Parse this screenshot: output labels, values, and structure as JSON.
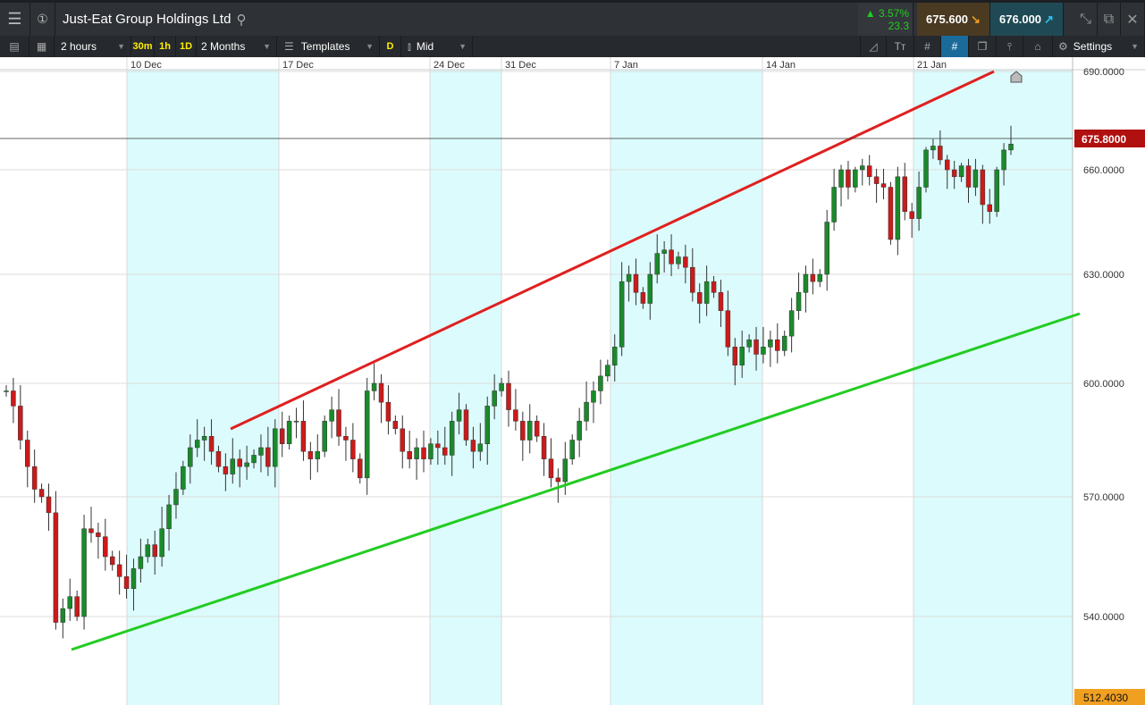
{
  "header": {
    "title": "Just-Eat Group Holdings Ltd",
    "change_pct": "3.57%",
    "change_abs": "23.3",
    "sell": "675.600",
    "buy": "676.000",
    "accent_up": "#22cc22",
    "sell_bg": "#4a3a22",
    "buy_bg": "#1f4a55"
  },
  "toolbar": {
    "interval": "2 hours",
    "quick": [
      "30m",
      "1h",
      "1D"
    ],
    "range": "2 Months",
    "templates": "Templates",
    "d": "D",
    "price_type": "Mid",
    "settings": "Settings"
  },
  "chart_data": {
    "type": "candlestick",
    "x_labels": [
      "10 Dec",
      "17 Dec",
      "24 Dec",
      "31 Dec",
      "7 Jan",
      "14 Jan",
      "21 Jan"
    ],
    "y_ticks": [
      "690.0000",
      "660.0000",
      "630.0000",
      "600.0000",
      "570.0000",
      "540.0000"
    ],
    "current_price": "675.8000",
    "bottom_label": "512.4030",
    "open": 598,
    "closes": [
      598,
      594,
      585,
      578,
      572,
      570,
      566,
      538,
      542,
      545,
      540,
      562,
      561,
      560,
      555,
      553,
      550,
      547,
      552,
      555,
      558,
      555,
      562,
      568,
      572,
      578,
      583,
      585,
      586,
      582,
      578,
      576,
      580,
      578,
      579,
      581,
      583,
      578,
      588,
      584,
      590,
      590,
      582,
      580,
      582,
      590,
      593,
      586,
      585,
      580,
      575,
      598,
      600,
      595,
      590,
      588,
      582,
      580,
      583,
      580,
      584,
      583,
      581,
      590,
      593,
      585,
      582,
      584,
      594,
      598,
      600,
      593,
      590,
      585,
      590,
      586,
      580,
      575,
      574,
      580,
      585,
      590,
      595,
      598,
      602,
      605,
      610,
      628,
      630,
      625,
      622,
      630,
      636,
      637,
      633,
      635,
      632,
      625,
      622,
      628,
      625,
      620,
      610,
      605,
      610,
      612,
      608,
      610,
      612,
      609,
      613,
      620,
      625,
      630,
      628,
      630,
      645,
      655,
      660,
      655,
      660,
      662,
      658,
      656,
      655,
      640,
      658,
      648,
      646,
      655,
      670,
      672,
      665,
      660,
      658,
      662,
      655,
      660,
      650,
      648,
      660,
      670,
      673
    ],
    "trendlines": [
      {
        "name": "resistance",
        "color": "#e02020"
      },
      {
        "name": "support",
        "color": "#22cc22"
      }
    ]
  }
}
